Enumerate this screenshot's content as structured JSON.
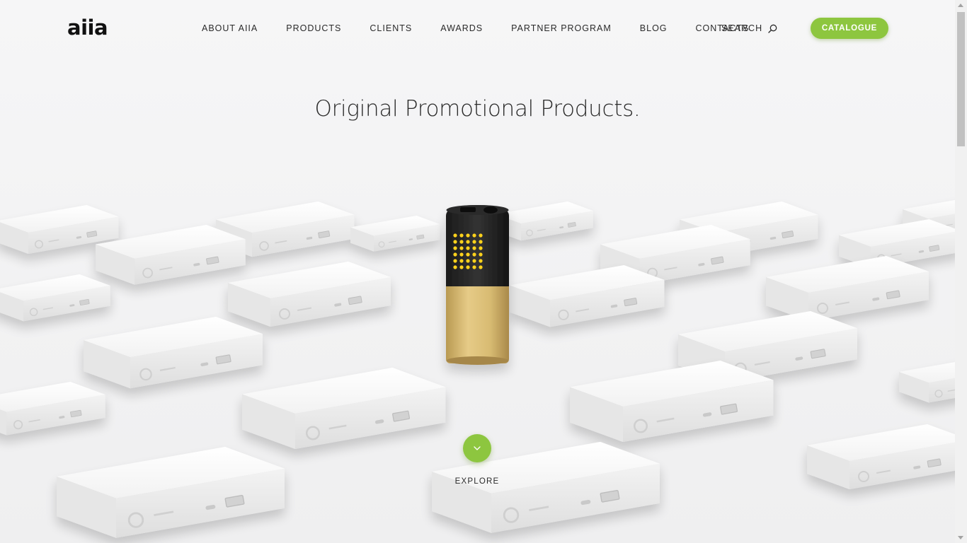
{
  "header": {
    "logo_text": "aiia",
    "nav": [
      {
        "label": "ABOUT AIIA"
      },
      {
        "label": "PRODUCTS"
      },
      {
        "label": "CLIENTS"
      },
      {
        "label": "AWARDS"
      },
      {
        "label": "PARTNER PROGRAM"
      },
      {
        "label": "BLOG"
      },
      {
        "label": "CONTACTS"
      }
    ],
    "search_label": "SEARCH",
    "catalogue_label": "CATALOGUE"
  },
  "hero": {
    "title": "Original Promotional Products.",
    "explore_label": "EXPLORE"
  },
  "colors": {
    "accent": "#8dc63f",
    "text": "#2a2a2a",
    "background": "#f4f4f5",
    "led": "#ffd21a",
    "gold": "#d6b770"
  },
  "icons": {
    "search": "search-icon",
    "explore": "chevron-down-icon"
  }
}
